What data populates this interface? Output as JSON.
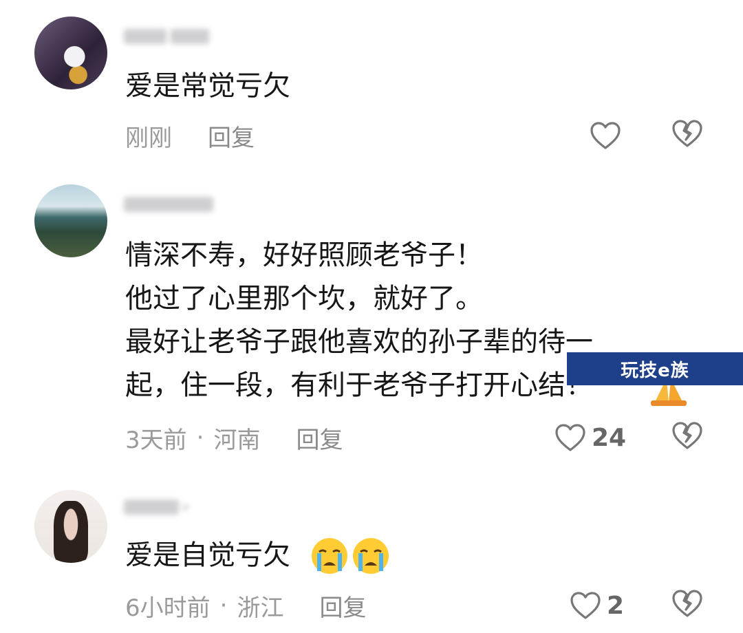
{
  "comments": [
    {
      "text_lines": [
        "爱是常觉亏欠"
      ],
      "time": "刚刚",
      "location": "",
      "reply_label": "回复",
      "like_count": ""
    },
    {
      "text_lines": [
        "情深不寿，好好照顾老爷子！",
        "他过了心里那个坎，就好了。",
        "最好让老爷子跟他喜欢的孙子辈的待一",
        "起，住一段，有利于老爷子打开心结！"
      ],
      "time": "3天前",
      "location": "河南",
      "reply_label": "回复",
      "like_count": "24"
    },
    {
      "text_lines": [
        "爱是自觉亏欠"
      ],
      "time": "6小时前",
      "location": "浙江",
      "reply_label": "回复",
      "like_count": "2"
    }
  ],
  "watermark": "玩技e族",
  "separator": "·",
  "icons": {
    "like": "heart-outline-icon",
    "dislike": "broken-heart-icon",
    "praying": "praying-hands-emoji",
    "crying": "crying-face-emoji"
  },
  "colors": {
    "text": "#161616",
    "meta": "#9a9a9a",
    "watermark_bg": "#1e3f8a"
  }
}
